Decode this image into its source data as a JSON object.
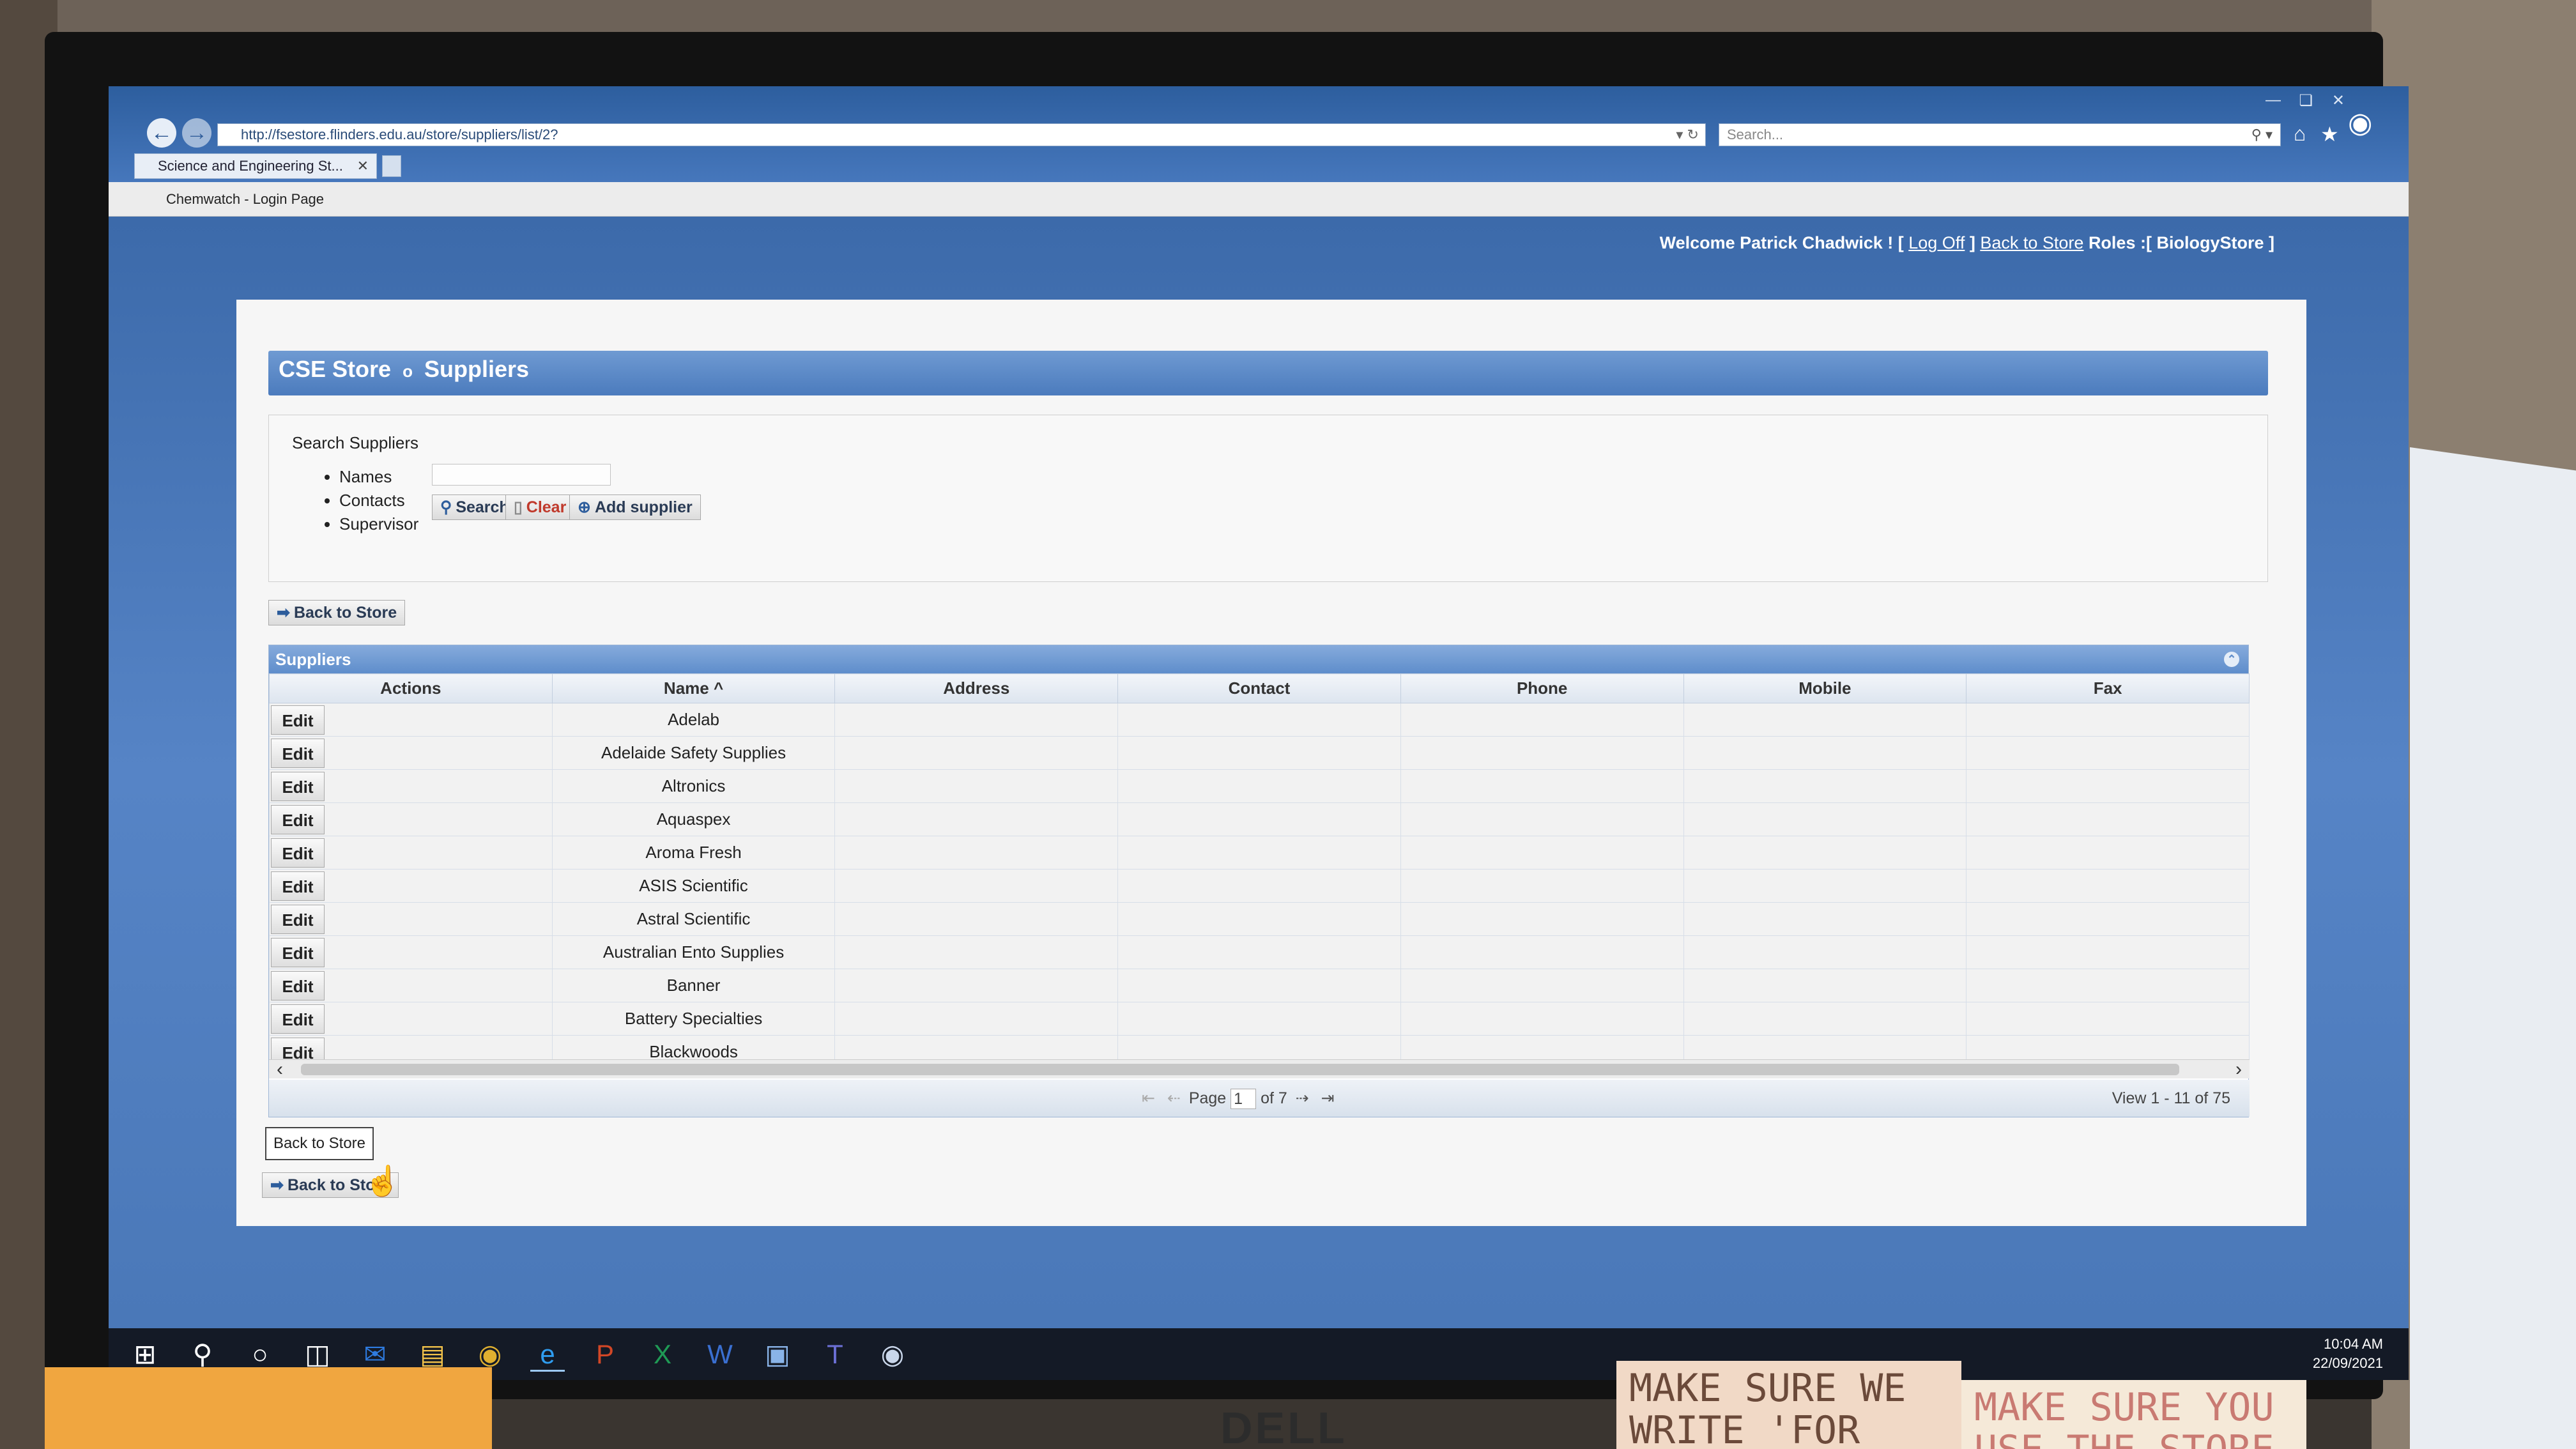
{
  "browser": {
    "url": "http://fsestore.flinders.edu.au/store/suppliers/list/2?",
    "search_placeholder": "Search...",
    "tab_title": "Science and Engineering St...",
    "favorite": "Chemwatch - Login Page"
  },
  "header": {
    "welcome": "Welcome",
    "user": "Patrick Chadwick",
    "logoff": "Log Off",
    "back_to_store": "Back to Store",
    "roles_label": "Roles :[",
    "role": "BiologyStore",
    "close_bracket": "]"
  },
  "panel": {
    "title_store": "CSE Store",
    "title_sep": "o",
    "title_page": "Suppliers",
    "search_label": "Search Suppliers",
    "options": [
      "Names",
      "Contacts",
      "Supervisor"
    ],
    "buttons": {
      "search": "Search",
      "clear": "Clear",
      "add": "Add supplier"
    },
    "back_to_store": "Back to Store"
  },
  "grid": {
    "caption": "Suppliers",
    "columns": [
      "Actions",
      "Name",
      "Address",
      "Contact",
      "Phone",
      "Mobile",
      "Fax"
    ],
    "sort_indicator": "^",
    "edit_label": "Edit",
    "rows": [
      "Adelab",
      "Adelaide Safety Supplies",
      "Altronics",
      "Aquaspex",
      "Aroma Fresh",
      "ASIS Scientific",
      "Astral Scientific",
      "Australian Ento Supplies",
      "Banner",
      "Battery Specialties",
      "Blackwoods"
    ],
    "pager": {
      "page_label": "Page",
      "page": "1",
      "of_label": "of 7",
      "view": "View 1 - 11 of 75"
    }
  },
  "tooltip": "Back to Store",
  "bottom_button": "Back to Store",
  "clock": {
    "time": "10:04 AM",
    "date": "22/09/2021"
  },
  "notes": {
    "left": "MAKE SURE WE WRITE 'FOR STORE'",
    "right": "MAKE SURE YOU USE THE STORE"
  }
}
